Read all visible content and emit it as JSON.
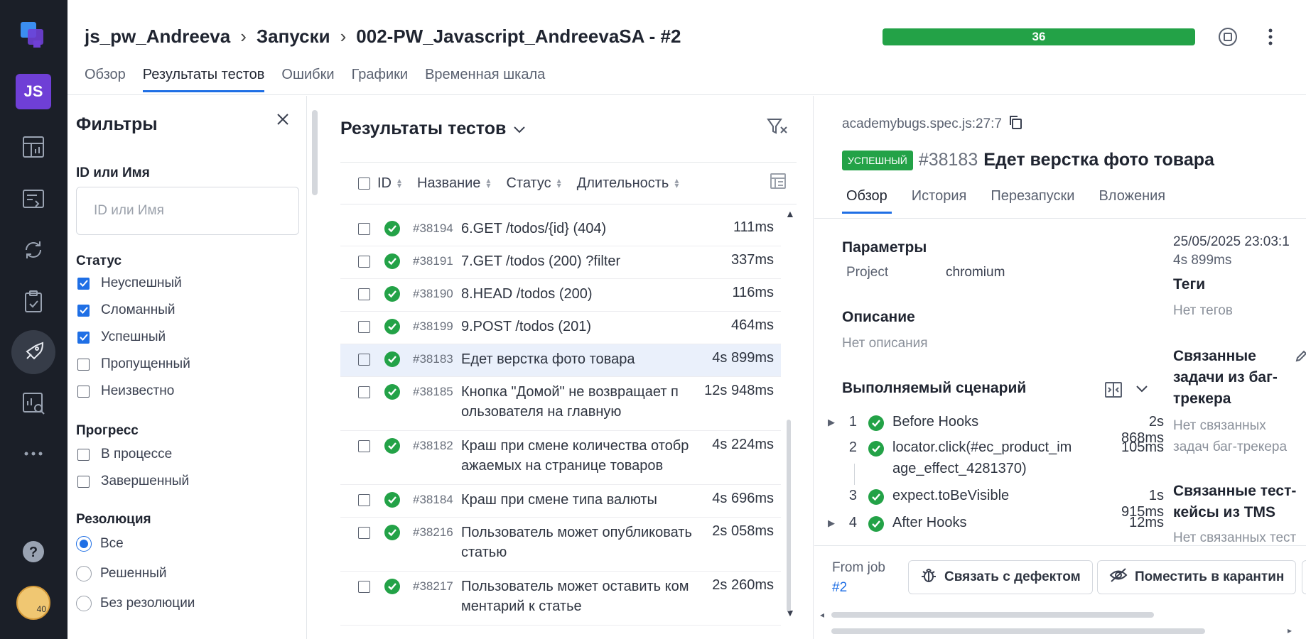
{
  "header": {
    "breadcrumb": [
      "js_pw_Andreeva",
      "Запуски",
      "002-PW_Javascript_AndreevaSA - #2"
    ],
    "progress_label": "36",
    "tabs": [
      "Обзор",
      "Результаты тестов",
      "Ошибки",
      "Графики",
      "Временная шкала"
    ],
    "active_tab": "Результаты тестов"
  },
  "rail": {
    "project_badge": "JS",
    "items": [
      "logo-icon",
      "dashboard-icon",
      "test-cases-icon",
      "launches-sync-icon",
      "checklist-icon",
      "rocket-icon",
      "analytics-icon",
      "more-icon",
      "help-icon"
    ],
    "avatar_text": "40"
  },
  "filters": {
    "title": "Фильтры",
    "id_label": "ID или Имя",
    "id_placeholder": "ID или Имя",
    "status_label": "Статус",
    "status_options": [
      {
        "label": "Неуспешный",
        "checked": true
      },
      {
        "label": "Сломанный",
        "checked": true
      },
      {
        "label": "Успешный",
        "checked": true
      },
      {
        "label": "Пропущенный",
        "checked": false
      },
      {
        "label": "Неизвестно",
        "checked": false
      }
    ],
    "progress_label": "Прогресс",
    "progress_options": [
      {
        "label": "В процессе",
        "checked": false
      },
      {
        "label": "Завершенный",
        "checked": false
      }
    ],
    "resolution_label": "Резолюция",
    "resolution_options": [
      {
        "label": "Все",
        "checked": true
      },
      {
        "label": "Решенный",
        "checked": false
      },
      {
        "label": "Без резолюции",
        "checked": false
      }
    ]
  },
  "results": {
    "title": "Результаты тестов",
    "columns": [
      "ID",
      "Название",
      "Статус",
      "Длительность"
    ],
    "rows": [
      {
        "id": "#38194",
        "name": "6.GET /todos/{id} (404)",
        "duration": "111ms",
        "selected": false
      },
      {
        "id": "#38191",
        "name": "7.GET /todos (200) ?filter",
        "duration": "337ms",
        "selected": false
      },
      {
        "id": "#38190",
        "name": "8.HEAD /todos (200)",
        "duration": "116ms",
        "selected": false
      },
      {
        "id": "#38199",
        "name": "9.POST /todos (201)",
        "duration": "464ms",
        "selected": false
      },
      {
        "id": "#38183",
        "name": "Едет верстка фото товара",
        "duration": "4s 899ms",
        "selected": true
      },
      {
        "id": "#38185",
        "name": "Кнопка \"Домой\" не возвращает п ользователя на главную",
        "duration": "12s 948ms",
        "selected": false
      },
      {
        "id": "#38182",
        "name": "Краш при смене количества отобр ажаемых на странице товаров",
        "duration": "4s 224ms",
        "selected": false
      },
      {
        "id": "#38184",
        "name": "Краш при смене типа валюты",
        "duration": "4s 696ms",
        "selected": false
      },
      {
        "id": "#38216",
        "name": "Пользователь может опубликовать статью",
        "duration": "2s 058ms",
        "selected": false
      },
      {
        "id": "#38217",
        "name": "Пользователь может оставить ком ментарий к статье",
        "duration": "2s 260ms",
        "selected": false
      }
    ]
  },
  "detail": {
    "file": "academybugs.spec.js:27:7",
    "status_badge": "УСПЕШНЫЙ",
    "test_id": "#38183",
    "test_name": "Едет верстка фото товара",
    "tabs": [
      "Обзор",
      "История",
      "Перезапуски",
      "Вложения"
    ],
    "active_tab": "Обзор",
    "params_title": "Параметры",
    "param_key": "Project",
    "param_value": "chromium",
    "desc_title": "Описание",
    "desc_value": "Нет описания",
    "scenario_title": "Выполняемый сценарий",
    "steps": [
      {
        "num": "1",
        "name": "Before Hooks",
        "duration": "2s 868ms",
        "expandable": true
      },
      {
        "num": "2",
        "name": "locator.click(#ec_product_im age_effect_4281370)",
        "duration": "105ms",
        "expandable": false
      },
      {
        "num": "3",
        "name": "expect.toBeVisible",
        "duration": "1s 915ms",
        "expandable": false
      },
      {
        "num": "4",
        "name": "After Hooks",
        "duration": "12ms",
        "expandable": true
      }
    ],
    "datetime": "25/05/2025 23:03:1",
    "duration": "4s 899ms",
    "tags_title": "Теги",
    "tags_value": "Нет тегов",
    "linked_issues_title": "Связанные задачи из баг-трекера",
    "linked_issues_value": "Нет связанных задач баг-трекера",
    "linked_tms_title": "Связанные тест-кейсы из TMS",
    "linked_tms_value": "Нет связанных тест",
    "from_job_label": "From job",
    "from_job_link": "#2",
    "link_defect_button": "Связать с дефектом",
    "quarantine_button": "Поместить в карантин"
  },
  "colors": {
    "rail_bg": "#1b1f28",
    "accent": "#1f6fe5",
    "success": "#23a247",
    "project_badge": "#6f3fd6",
    "selected_row": "#eaf0fb"
  }
}
